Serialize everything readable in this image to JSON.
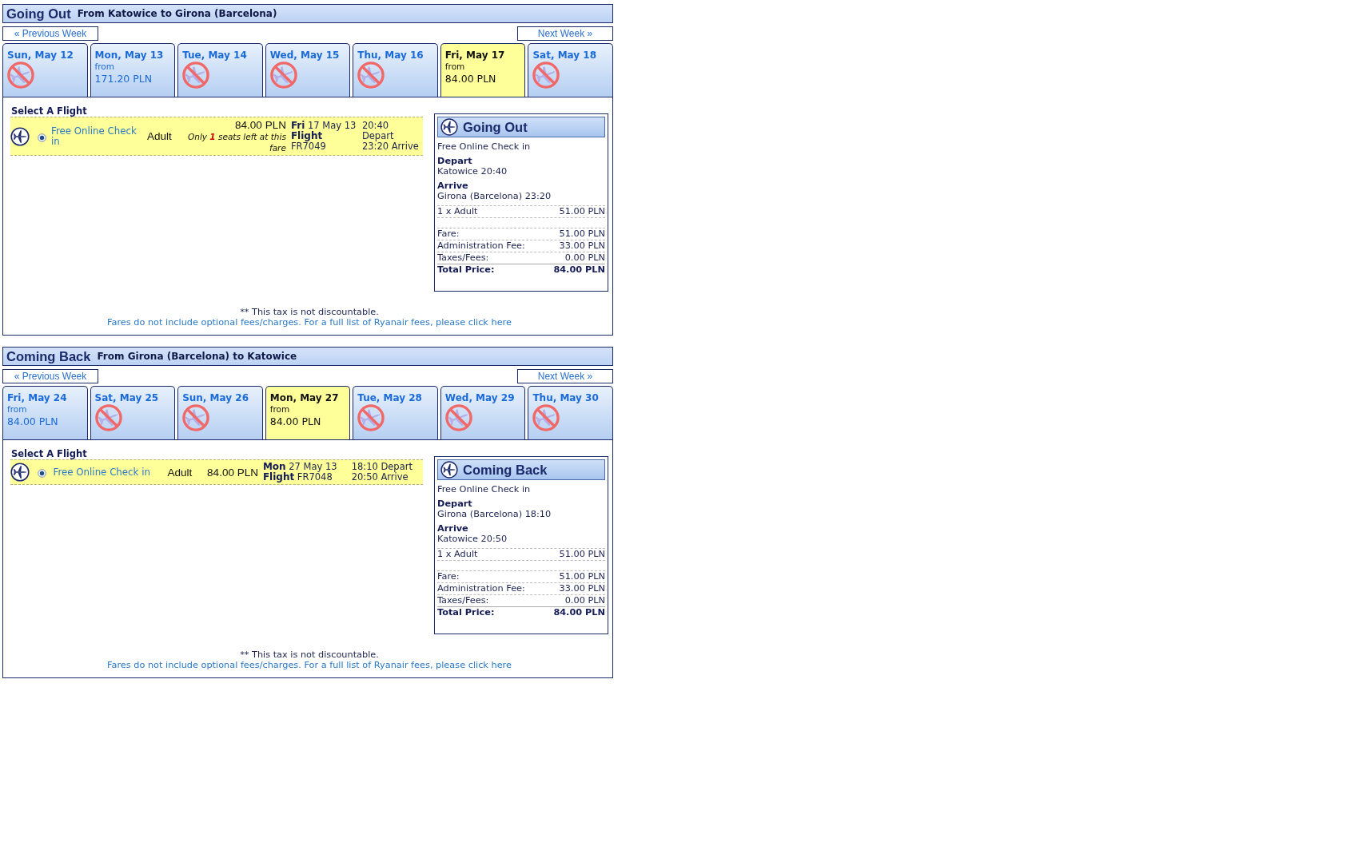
{
  "sections": [
    {
      "title": "Going Out",
      "route": "From Katowice to Girona (Barcelona)",
      "prev_week": "« Previous Week",
      "next_week": "Next Week »",
      "days": [
        {
          "date": "Sun, May 12",
          "kind": "none",
          "selected": false
        },
        {
          "date": "Mon, May 13",
          "kind": "fare",
          "from": "from",
          "price": "171.20 PLN",
          "selected": false
        },
        {
          "date": "Tue, May 14",
          "kind": "none",
          "selected": false
        },
        {
          "date": "Wed, May 15",
          "kind": "none",
          "selected": false
        },
        {
          "date": "Thu, May 16",
          "kind": "none",
          "selected": false
        },
        {
          "date": "Fri, May 17",
          "kind": "fare",
          "from": "from",
          "price": "84.00 PLN",
          "selected": true
        },
        {
          "date": "Sat, May 18",
          "kind": "none",
          "selected": false
        }
      ],
      "flight_list": {
        "heading": "Select A Flight",
        "flights": [
          {
            "checkin": "Free Online Check in",
            "selected": true,
            "passenger": "Adult",
            "price": "84.00 PLN",
            "seats_note": "Only **1** seats left at this fare",
            "date": "**Fri** 17 May 13",
            "flight": "**Flight** FR7049",
            "depart": "20:40 Depart",
            "arrive": "23:20 Arrive"
          }
        ]
      },
      "summary": {
        "title": "Going Out",
        "checkin": "Free Online Check in",
        "depart_label": "Depart",
        "depart": "Katowice 20:40",
        "arrive_label": "Arrive",
        "arrive": "Girona (Barcelona) 23:20",
        "passengers": [
          {
            "label": "1 x Adult",
            "amount": "51.00 PLN"
          }
        ],
        "charges": [
          {
            "kind": "line",
            "label": "Fare:",
            "amount": "51.00 PLN"
          },
          {
            "kind": "line",
            "label": "Administration Fee:",
            "amount": "33.00 PLN"
          },
          {
            "kind": "line",
            "label": "Taxes/Fees:",
            "amount": "0.00 PLN"
          },
          {
            "kind": "total",
            "label": "Total Price:",
            "amount": "84.00 PLN"
          }
        ]
      },
      "note": "** This tax is not discountable.",
      "fees_link": "Fares do not include optional fees/charges. For a full list of Ryanair fees, please click here"
    },
    {
      "title": "Coming Back",
      "route": "From Girona (Barcelona) to Katowice",
      "prev_week": "« Previous Week",
      "next_week": "Next Week »",
      "days": [
        {
          "date": "Fri, May 24",
          "kind": "fare",
          "from": "from",
          "price": "84.00 PLN",
          "selected": false
        },
        {
          "date": "Sat, May 25",
          "kind": "none",
          "selected": false
        },
        {
          "date": "Sun, May 26",
          "kind": "none",
          "selected": false
        },
        {
          "date": "Mon, May 27",
          "kind": "fare",
          "from": "from",
          "price": "84.00 PLN",
          "selected": true
        },
        {
          "date": "Tue, May 28",
          "kind": "none",
          "selected": false
        },
        {
          "date": "Wed, May 29",
          "kind": "none",
          "selected": false
        },
        {
          "date": "Thu, May 30",
          "kind": "none",
          "selected": false
        }
      ],
      "flight_list": {
        "heading": "Select A Flight",
        "flights": [
          {
            "checkin": "Free Online Check in",
            "selected": true,
            "passenger": "Adult",
            "price": "84.00 PLN",
            "date": "**Mon** 27 May 13",
            "flight": "**Flight** FR7048",
            "depart": "18:10 Depart",
            "arrive": "20:50 Arrive"
          }
        ]
      },
      "summary": {
        "title": "Coming Back",
        "checkin": "Free Online Check in",
        "depart_label": "Depart",
        "depart": "Girona (Barcelona) 18:10",
        "arrive_label": "Arrive",
        "arrive": "Katowice 20:50",
        "passengers": [
          {
            "label": "1 x Adult",
            "amount": "51.00 PLN"
          }
        ],
        "charges": [
          {
            "kind": "line",
            "label": "Fare:",
            "amount": "51.00 PLN"
          },
          {
            "kind": "line",
            "label": "Administration Fee:",
            "amount": "33.00 PLN"
          },
          {
            "kind": "line",
            "label": "Taxes/Fees:",
            "amount": "0.00 PLN"
          },
          {
            "kind": "total",
            "label": "Total Price:",
            "amount": "84.00 PLN"
          }
        ]
      },
      "note": "** This tax is not discountable.",
      "fees_link": "Fares do not include optional fees/charges. For a full list of Ryanair fees, please click here"
    }
  ]
}
